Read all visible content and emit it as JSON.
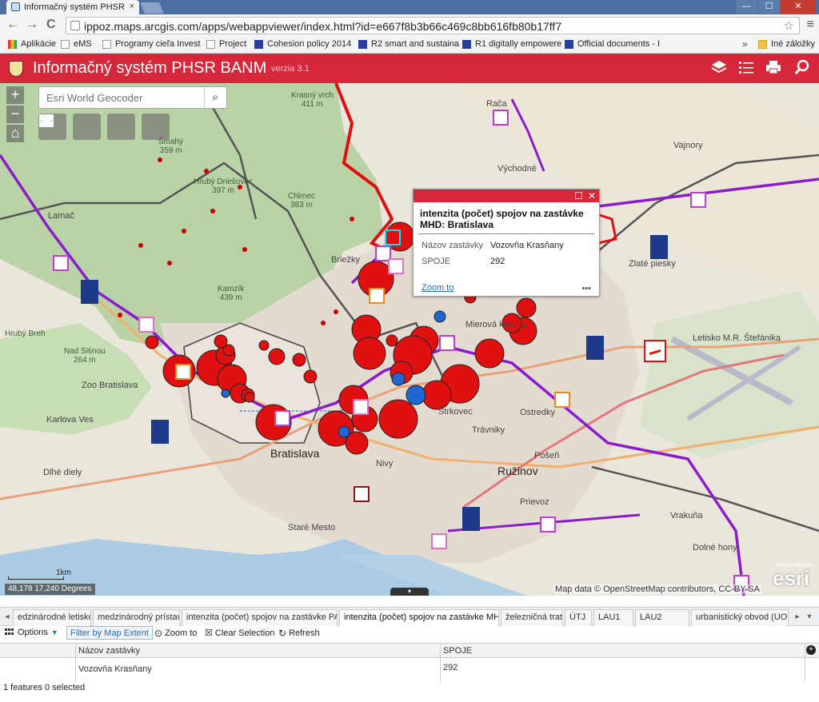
{
  "browser": {
    "tab_title": "Informačný systém PHSR",
    "tab_close": "×",
    "url": "ippoz.maps.arcgis.com/apps/webappviewer/index.html?id=e667f8b3b66c469c8bb616fb80b17ff7",
    "win_minimize": "—",
    "win_maximize": "☐",
    "win_close": "✕",
    "back": "←",
    "forward": "→",
    "reload": "C",
    "star": "☆",
    "menu": "≡",
    "bookmarks": [
      {
        "label": "Aplikácie",
        "icon": "apps"
      },
      {
        "label": "eMS",
        "icon": "page"
      },
      {
        "label": "Programy cieľa Invest",
        "icon": "page"
      },
      {
        "label": "Project",
        "icon": "page"
      },
      {
        "label": "Cohesion policy 2014",
        "icon": "eu"
      },
      {
        "label": "R2 smart and sustaina",
        "icon": "eu"
      },
      {
        "label": "R1 digitally empowere",
        "icon": "eu"
      },
      {
        "label": "Official documents - I",
        "icon": "eu"
      }
    ],
    "bookmarks_more": "»",
    "other_bookmarks": "Iné záložky"
  },
  "app": {
    "title": "Informačný systém PHSR BANM",
    "version": "verzia 3.1",
    "header_icons": [
      "layers-icon",
      "list-icon",
      "print-icon",
      "query-icon"
    ]
  },
  "map": {
    "zoom_in": "+",
    "zoom_out": "−",
    "home": "⌂",
    "search_placeholder": "Esri World Geocoder",
    "search_icon": "⌕",
    "tools": [
      "basemap-gallery-icon",
      "print-icon",
      "swipe-icon",
      "measurement-icon"
    ],
    "labels": [
      {
        "text": "Rača"
      },
      {
        "text": "Vajnory"
      },
      {
        "text": "Východné"
      },
      {
        "text": "Lamač"
      },
      {
        "text": "Briežky"
      },
      {
        "text": "Mierová kolónia"
      },
      {
        "text": "Bratislava"
      },
      {
        "text": "Nivy"
      },
      {
        "text": "Ružinov"
      },
      {
        "text": "Trávniky"
      },
      {
        "text": "Prievoz"
      },
      {
        "text": "Staré Mesto"
      },
      {
        "text": "Ostredky"
      },
      {
        "text": "Štrkovec"
      },
      {
        "text": "Pošeň"
      },
      {
        "text": "Karlova Ves"
      },
      {
        "text": "Dlhé diely"
      },
      {
        "text": "Zoo Bratislava"
      },
      {
        "text": "Vrakuňa"
      },
      {
        "text": "Dolné hony"
      },
      {
        "text": "Letisko M.R. Štefánika"
      },
      {
        "text": "Zlaté piesky"
      }
    ],
    "forest_labels": [
      {
        "text": "Krasný vrch\n411 m"
      },
      {
        "text": "Šmahý\n359 m"
      },
      {
        "text": "Hrubý Driešovec\n397 m"
      },
      {
        "text": "Chlmec\n383 m"
      },
      {
        "text": "Kamzík\n439 m"
      },
      {
        "text": "Nad Sitinou\n264 m"
      },
      {
        "text": "Hrubý Breh"
      }
    ],
    "coordinates": "48,178 17,240 Degrees",
    "scale": "1km",
    "attribution": "Map data © OpenStreetMap contributors, CC-BY-SA",
    "esri": "esri",
    "esri_powered": "POWERED BY",
    "handle": "▾"
  },
  "popup": {
    "title": "intenzita (počet) spojov na zastávke MHD: Bratislava",
    "maximize": "☐",
    "close": "✕",
    "field1_key": "Názov zastávky",
    "field1_val": "Vozovňa Krasňany",
    "field2_key": "SPOJE",
    "field2_val": "292",
    "zoom_to": "Zoom to",
    "more": "•••"
  },
  "attribute_table": {
    "scroll_left": "◂",
    "scroll_right": "▸",
    "dropdown": "▾",
    "tabs": [
      {
        "label": "edzinárodné letisko",
        "active": false
      },
      {
        "label": "medzinárodný prístav",
        "active": false
      },
      {
        "label": "intenzita (počet) spojov na zastávke PAD",
        "active": false
      },
      {
        "label": "intenzita (počet) spojov na zastávke MHD",
        "active": true
      },
      {
        "label": "železničná trať",
        "active": false
      },
      {
        "label": "ÚTJ",
        "active": false
      },
      {
        "label": "LAU1",
        "active": false
      },
      {
        "label": "LAU2",
        "active": false
      },
      {
        "label": "urbanistický obvod (UO)",
        "active": false
      }
    ],
    "toolbar": {
      "options": "Options",
      "filter": "Filter by Map Extent",
      "zoom_to": "Zoom to",
      "clear_selection": "Clear Selection",
      "refresh": "Refresh"
    },
    "columns": [
      "Názov zastávky",
      "SPOJE"
    ],
    "rows": [
      [
        "Vozovňa Krasňany",
        "292"
      ]
    ],
    "add_column": "+",
    "status": "1 features 0 selected"
  },
  "colors": {
    "brand": "#d6283a",
    "symbol_red": "#e01010",
    "symbol_blue": "#1f66d1",
    "route_purple": "#8a1ccc"
  }
}
